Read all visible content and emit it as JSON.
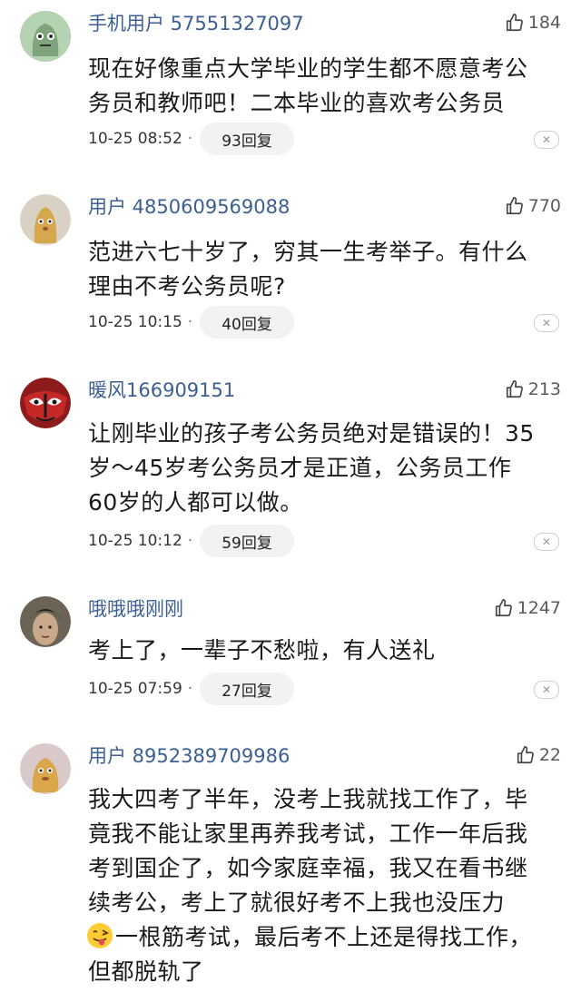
{
  "comments": [
    {
      "username": "手机用户 57551327097",
      "likes": "184",
      "lines": [
        "现在好像重点大学毕业的学生都不愿意考公",
        "务员和教师吧！二本毕业的喜欢考公务员"
      ],
      "time": "10-25 08:52",
      "replies": "93回复"
    },
    {
      "username": "用户 4850609569088",
      "likes": "770",
      "lines": [
        "范进六七十岁了，穷其一生考举子。有什么",
        "理由不考公务员呢?"
      ],
      "time": "10-25 10:15",
      "replies": "40回复"
    },
    {
      "username": "暖风166909151",
      "likes": "213",
      "lines": [
        "让刚毕业的孩子考公务员绝对是错误的！35",
        "岁～45岁考公务员才是正道，公务员工作",
        "60岁的人都可以做。"
      ],
      "time": "10-25 10:12",
      "replies": "59回复"
    },
    {
      "username": "哦哦哦刚刚",
      "likes": "1247",
      "lines": [
        "考上了，一辈子不愁啦，有人送礼"
      ],
      "time": "10-25 07:59",
      "replies": "27回复"
    },
    {
      "username": "用户 8952389709986",
      "likes": "22",
      "lines": [
        "我大四考了半年，没考上我就找工作了，毕",
        "竟我不能让家里再养我考试，工作一年后我",
        "考到国企了，如今家庭幸福，我又在看书继",
        "续考公，考上了就很好考不上我也没压力",
        "一根筋考试，最后考不上还是得找工作，",
        "但都脱轨了"
      ]
    }
  ],
  "separator": "·",
  "dismiss_glyph": "✕",
  "colors": {
    "username": "#3c5f93",
    "text": "#1a1a1a",
    "reply_bg": "#f2f2f2"
  },
  "icons": {
    "like": "thumbs-up-icon",
    "dismiss": "close-icon",
    "emoji": "winking-tongue-emoji-icon"
  }
}
